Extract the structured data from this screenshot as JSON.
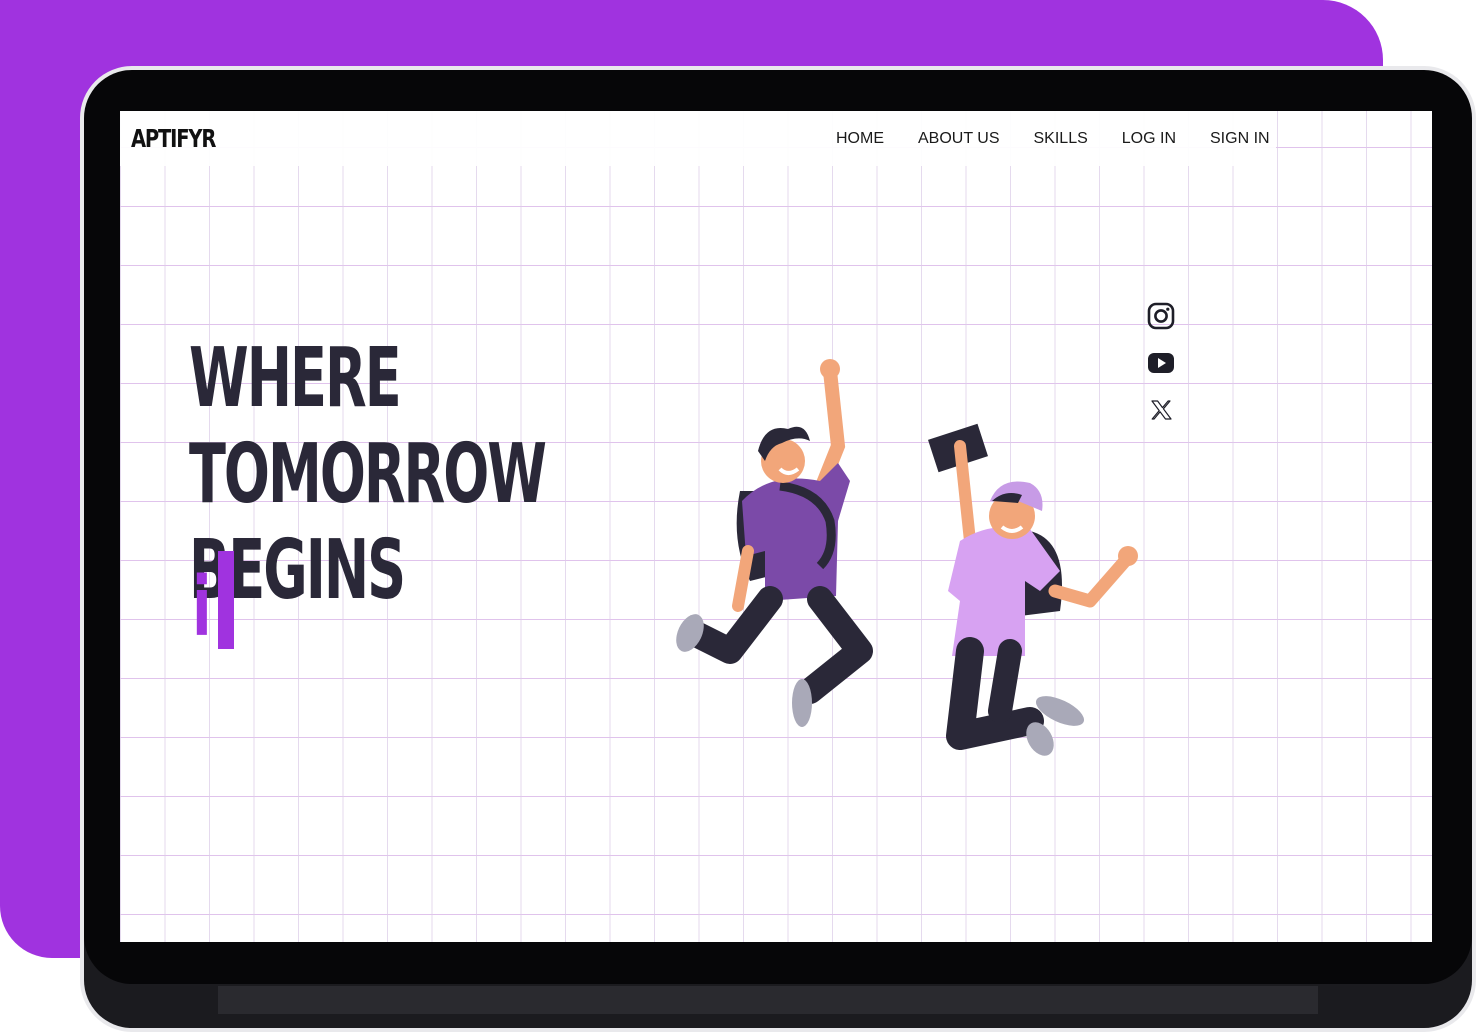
{
  "brand": {
    "logo": "APTIFYR"
  },
  "nav": {
    "items": [
      {
        "label": "HOME"
      },
      {
        "label": "ABOUT US"
      },
      {
        "label": "SKILLS"
      },
      {
        "label": "LOG IN"
      },
      {
        "label": "SIGN IN"
      }
    ]
  },
  "hero": {
    "title_line1": "WHERE TOMORROW",
    "title_line2": "BEGINS",
    "typed_text": "i"
  },
  "social": {
    "icons": [
      "instagram-icon",
      "youtube-icon",
      "x-icon"
    ]
  },
  "colors": {
    "accent": "#a033df",
    "heading": "#2a2838",
    "device": "#060608"
  }
}
